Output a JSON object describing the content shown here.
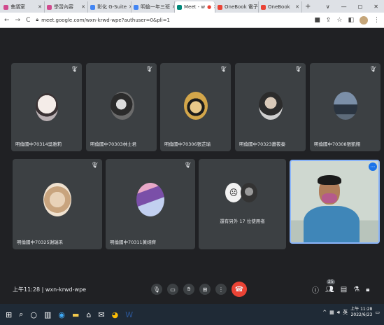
{
  "browser": {
    "tabs": [
      {
        "label": "會議室",
        "fav": "#d14a8e"
      },
      {
        "label": "學習內容",
        "fav": "#d14a8e"
      },
      {
        "label": "彰化 G-Suite",
        "fav": "#4285f4"
      },
      {
        "label": "明倫一年三班",
        "fav": "#4285f4"
      },
      {
        "label": "Meet - w",
        "fav": "#00897b"
      },
      {
        "label": "OneBook 電子",
        "fav": "#ea4335"
      },
      {
        "label": "OneBook",
        "fav": "#ea4335"
      }
    ],
    "url": "meet.google.com/wxn-krwd-wpe?authuser=0&pli=1",
    "new_tab": "+",
    "window": [
      "∨",
      "—",
      "◻",
      "✕"
    ]
  },
  "participants": [
    {
      "name": "明倫國中70314吳雅莉"
    },
    {
      "name": "明倫國中70303林士君"
    },
    {
      "name": "明倫國中70306張芷瑜"
    },
    {
      "name": "明倫國中70323蕭筱秦"
    },
    {
      "name": "明倫國中70308張凱翔"
    },
    {
      "name": "明倫國中70325謝瑞禾"
    },
    {
      "name": "明倫國中70311黃翊齊"
    }
  ],
  "others_tile": {
    "label": "還有另外 17 位使用者"
  },
  "bottom": {
    "time": "上午11:28",
    "separator": "|",
    "meeting_code": "wxn-krwd-wpe",
    "participant_count": "25"
  },
  "taskbar": {
    "clock_time": "上午 11:28",
    "clock_date": "2022/6/23",
    "tray_label": "英"
  }
}
